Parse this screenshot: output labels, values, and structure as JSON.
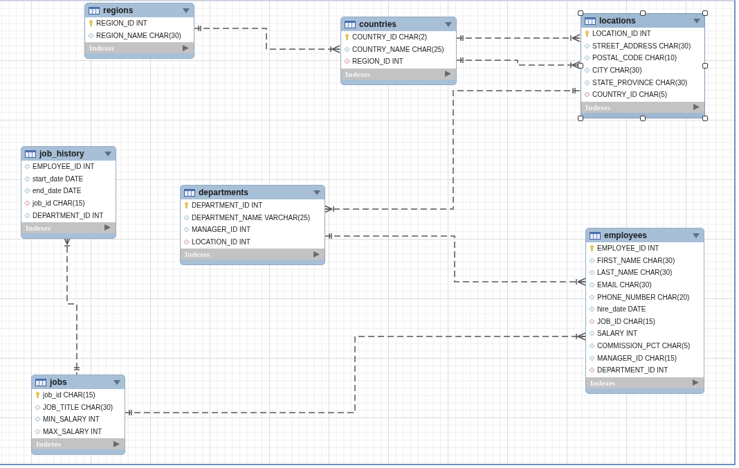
{
  "tables": [
    {
      "name": "regions",
      "selected": false,
      "columns": [
        {
          "kind": "pk",
          "label": "REGION_ID INT"
        },
        {
          "kind": "plain",
          "label": "REGION_NAME CHAR(30)"
        }
      ],
      "indexes_label": "Indexes"
    },
    {
      "name": "countries",
      "selected": false,
      "columns": [
        {
          "kind": "pk",
          "label": "COUNTRY_ID CHAR(2)"
        },
        {
          "kind": "plain",
          "label": "COUNTRY_NAME CHAR(25)"
        },
        {
          "kind": "fk",
          "label": "REGION_ID INT"
        }
      ],
      "indexes_label": "Indexes"
    },
    {
      "name": "locations",
      "selected": true,
      "columns": [
        {
          "kind": "pk",
          "label": "LOCATION_ID INT"
        },
        {
          "kind": "plain",
          "label": "STREET_ADDRESS CHAR(30)"
        },
        {
          "kind": "plain",
          "label": "POSTAL_CODE CHAR(10)"
        },
        {
          "kind": "plain",
          "label": "CITY CHAR(30)"
        },
        {
          "kind": "plain",
          "label": "STATE_PROVINCE CHAR(30)"
        },
        {
          "kind": "fk",
          "label": "COUNTRY_ID CHAR(5)"
        }
      ],
      "indexes_label": "Indexes"
    },
    {
      "name": "job_history",
      "selected": false,
      "columns": [
        {
          "kind": "plain",
          "label": "EMPLOYEE_ID INT"
        },
        {
          "kind": "plain",
          "label": "start_date DATE"
        },
        {
          "kind": "plain",
          "label": "end_date DATE"
        },
        {
          "kind": "fk",
          "label": "job_id CHAR(15)"
        },
        {
          "kind": "plain",
          "label": "DEPARTMENT_ID INT"
        }
      ],
      "indexes_label": "Indexes"
    },
    {
      "name": "departments",
      "selected": false,
      "columns": [
        {
          "kind": "pk",
          "label": "DEPARTMENT_ID INT"
        },
        {
          "kind": "plain",
          "label": "DEPARTMENT_NAME VARCHAR(25)"
        },
        {
          "kind": "plain",
          "label": "MANAGER_ID INT"
        },
        {
          "kind": "fk",
          "label": "LOCATION_ID INT"
        }
      ],
      "indexes_label": "Indexes"
    },
    {
      "name": "employees",
      "selected": false,
      "columns": [
        {
          "kind": "pk",
          "label": "EMPLOYEE_ID INT"
        },
        {
          "kind": "plain",
          "label": "FIRST_NAME CHAR(30)"
        },
        {
          "kind": "plain",
          "label": "LAST_NAME CHAR(30)"
        },
        {
          "kind": "plain",
          "label": "EMAIL CHAR(30)"
        },
        {
          "kind": "plain",
          "label": "PHONE_NUMBER CHAR(20)"
        },
        {
          "kind": "plain",
          "label": "hire_date DATE"
        },
        {
          "kind": "fk",
          "label": "JOB_ID CHAR(15)"
        },
        {
          "kind": "plain",
          "label": "SALARY INT"
        },
        {
          "kind": "plain",
          "label": "COMMISSION_PCT CHAR(5)"
        },
        {
          "kind": "plain",
          "label": "MANAGER_ID CHAR(15)"
        },
        {
          "kind": "fk",
          "label": "DEPARTMENT_ID INT"
        }
      ],
      "indexes_label": "Indexes"
    },
    {
      "name": "jobs",
      "selected": false,
      "columns": [
        {
          "kind": "pk",
          "label": "job_id CHAR(15)"
        },
        {
          "kind": "plain",
          "label": "JOB_TITLE CHAR(30)"
        },
        {
          "kind": "plain",
          "label": "MIN_SALARY INT"
        },
        {
          "kind": "plain",
          "label": "MAX_SALARY INT"
        }
      ],
      "indexes_label": "Indexes"
    }
  ]
}
